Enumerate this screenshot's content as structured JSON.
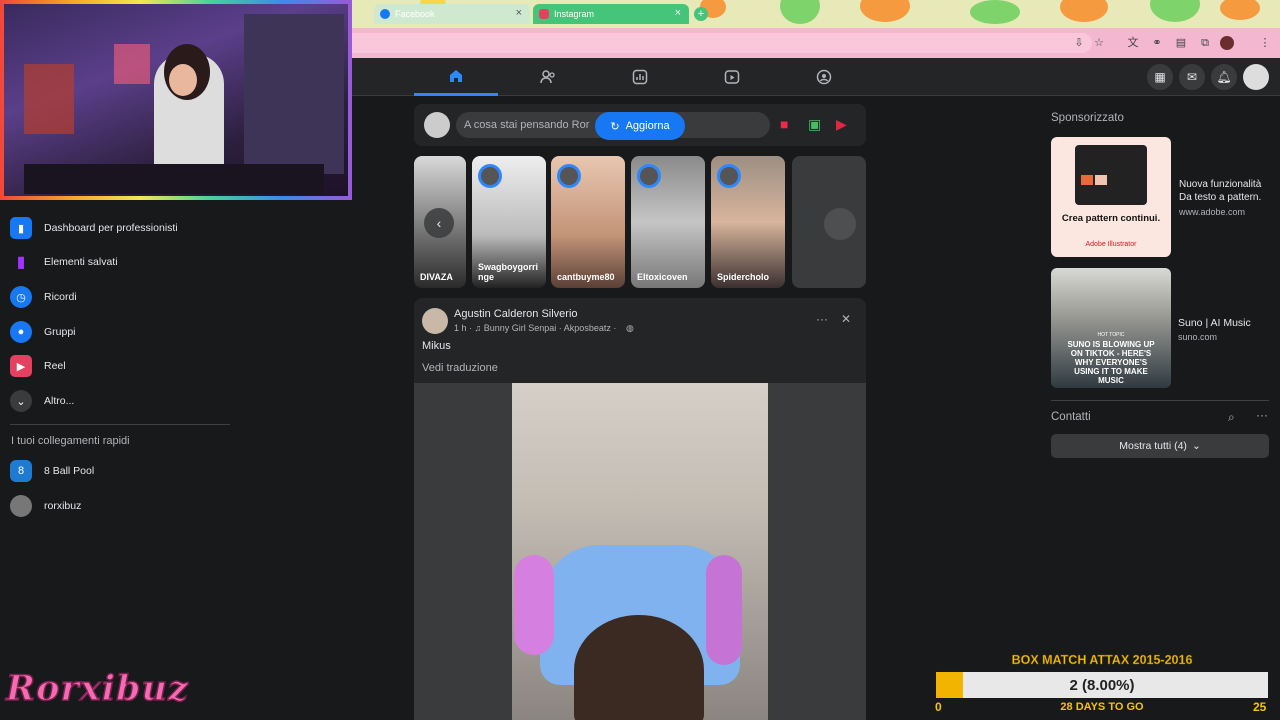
{
  "browser": {
    "tabs": [
      {
        "label": "Facebook",
        "icon": "facebook-icon"
      },
      {
        "label": "Instagram",
        "icon": "instagram-icon"
      }
    ],
    "new_tab": "+",
    "close": "×"
  },
  "facebook": {
    "nav_tabs": [
      "home-icon",
      "friends-icon",
      "dashboard-icon",
      "video-icon",
      "groups-icon"
    ],
    "sidebar": {
      "items": [
        {
          "label": "Dashboard per professionisti",
          "icon": "dashboard-icon",
          "color": "#1877f2"
        },
        {
          "label": "Elementi salvati",
          "icon": "bookmark-icon",
          "color": "#a033ff"
        },
        {
          "label": "Ricordi",
          "icon": "clock-icon",
          "color": "#1877f2"
        },
        {
          "label": "Gruppi",
          "icon": "groups-icon",
          "color": "#1877f2"
        },
        {
          "label": "Reel",
          "icon": "reel-icon",
          "color": "#e4405f"
        },
        {
          "label": "Altro...",
          "icon": "chevron-down-icon",
          "color": "#3a3b3c"
        }
      ],
      "shortcuts_title": "I tuoi collegamenti rapidi",
      "shortcuts": [
        {
          "label": "8 Ball Pool",
          "icon": "8-ball-pool-icon"
        },
        {
          "label": "rorxibuz",
          "icon": "avatar"
        }
      ]
    },
    "composer": {
      "placeholder": "A cosa stai pensando Ror",
      "update_button": "Aggiorna"
    },
    "stories": [
      {
        "name": "DIVAZA"
      },
      {
        "name": "Swagboygorri nge"
      },
      {
        "name": "cantbuyme80"
      },
      {
        "name": "Eltoxicoven"
      },
      {
        "name": "Spidercholo"
      },
      {
        "name": ""
      }
    ],
    "post": {
      "author": "Agustin Calderon Silverio",
      "meta": "1 h · ♫ Bunny Girl Senpai · Akposbeatz · ",
      "text": "Mikus",
      "translate": "Vedi traduzione",
      "more": "···",
      "close": "✕"
    },
    "right": {
      "sponsored_title": "Sponsorizzato",
      "ads": [
        {
          "title": "Nuova funzionalità Da testo a pattern.",
          "domain": "www.adobe.com",
          "img_caption": "Crea pattern continui.",
          "img_brand": "Adobe Illustrator"
        },
        {
          "title": "Suno | AI Music",
          "domain": "suno.com",
          "img_caption": "SUNO IS BLOWING UP ON TIKTOK - HERE'S WHY EVERYONE'S USING IT TO MAKE MUSIC",
          "img_tag": "HOT TOPIC"
        }
      ],
      "contacts_title": "Contatti",
      "show_all": "Mostra tutti (4)"
    }
  },
  "overlay": {
    "streamer_name": "Rorxibuz",
    "goal": {
      "title": "BOX MATCH ATTAX 2015-2016",
      "value": "2 (8.00%)",
      "current": 2,
      "target": 25,
      "min_label": "0",
      "max_label": "25",
      "days": "28 DAYS TO GO",
      "fraction": 0.08
    }
  },
  "colors": {
    "accent": "#2d88ff",
    "goal_fill": "#f2b400",
    "goal_text": "#f5c400"
  }
}
